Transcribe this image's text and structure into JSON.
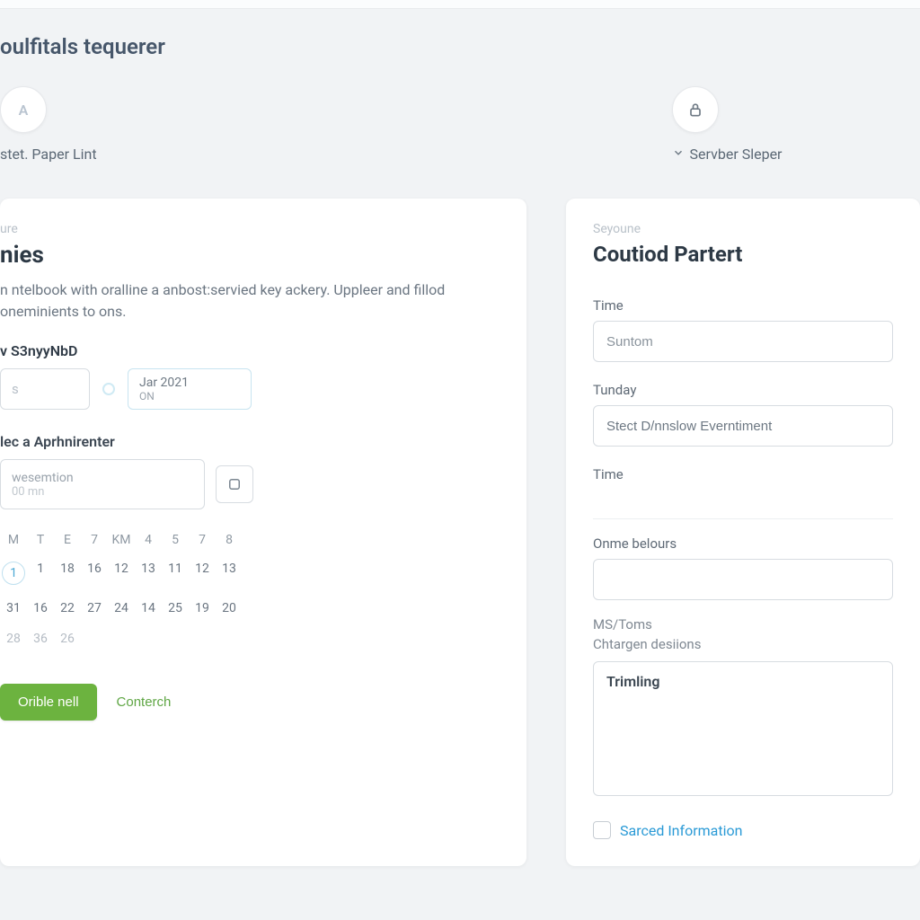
{
  "page": {
    "title": "oulfitals tequerer"
  },
  "steps": {
    "left": {
      "letter": "A",
      "label": "stet. Paper Lint"
    },
    "right": {
      "label": "Servber Sleper"
    }
  },
  "left_card": {
    "eyebrow": "ure",
    "title": "nies",
    "description": "n ntelbook with oralline a anbost:servied key ackery. Uppleer and fillod oneminients to ons.",
    "group1_label": "v S3nyyNbD",
    "date_select": {
      "line1": "Jar 2021",
      "line2": "ON"
    },
    "group2_label": "lec a  Aprhnirenter",
    "textbox": {
      "line1": "wesemtion",
      "line2": "00 mn"
    },
    "calendar": {
      "headers": [
        "M",
        "T",
        "E",
        "7",
        "KM",
        "4",
        "5",
        "7",
        "8"
      ],
      "rows": [
        [
          "1",
          "1",
          "18",
          "16",
          "12",
          "13",
          "11",
          "12",
          "13"
        ],
        [
          "31",
          "16",
          "22",
          "27",
          "24",
          "14",
          "25",
          "19",
          "20"
        ],
        [
          "28",
          "36",
          "26",
          "",
          "",
          "",
          "",
          "",
          ""
        ]
      ],
      "today_col": 0
    },
    "actions": {
      "primary": "Orible nell",
      "secondary": "Conterch"
    }
  },
  "right_card": {
    "eyebrow": "Seyoune",
    "title": "Coutiod Partert",
    "fields": {
      "time_label": "Time",
      "time_value": "Suntom",
      "tunday_label": "Tunday",
      "tunday_value": "Stect D/nnslow Everntiment",
      "time2_label": "Time",
      "onme_label": "Onme belours",
      "ms_label": "MS/Toms",
      "chtargen_label": "Chtargen desiions",
      "textarea_value": "Trimling",
      "checkbox_label": "Sarced Information"
    }
  }
}
